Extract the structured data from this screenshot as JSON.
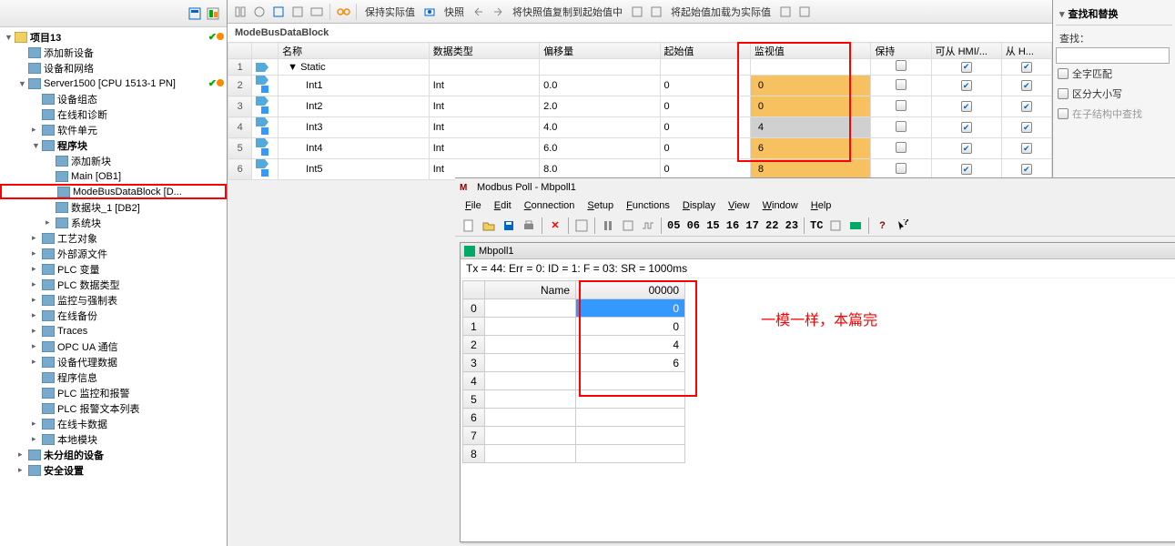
{
  "tree": {
    "root": "项目13",
    "items": [
      {
        "label": "添加新设备",
        "indent": 1,
        "arrow": "",
        "icon": "add-device"
      },
      {
        "label": "设备和网络",
        "indent": 1,
        "arrow": "",
        "icon": "network"
      },
      {
        "label": "Server1500 [CPU 1513-1 PN]",
        "indent": 1,
        "arrow": "▼",
        "icon": "plc",
        "status": true
      },
      {
        "label": "设备组态",
        "indent": 2,
        "arrow": "",
        "icon": "config"
      },
      {
        "label": "在线和诊断",
        "indent": 2,
        "arrow": "",
        "icon": "online"
      },
      {
        "label": "软件单元",
        "indent": 2,
        "arrow": "▸",
        "icon": "software"
      },
      {
        "label": "程序块",
        "indent": 2,
        "arrow": "▼",
        "icon": "blocks",
        "bold": true
      },
      {
        "label": "添加新块",
        "indent": 3,
        "arrow": "",
        "icon": "add-block"
      },
      {
        "label": "Main [OB1]",
        "indent": 3,
        "arrow": "",
        "icon": "ob"
      },
      {
        "label": "ModeBusDataBlock [D...",
        "indent": 3,
        "arrow": "",
        "icon": "db",
        "highlighted": true
      },
      {
        "label": "数据块_1 [DB2]",
        "indent": 3,
        "arrow": "",
        "icon": "db"
      },
      {
        "label": "系统块",
        "indent": 3,
        "arrow": "▸",
        "icon": "sys"
      },
      {
        "label": "工艺对象",
        "indent": 2,
        "arrow": "▸",
        "icon": "tech"
      },
      {
        "label": "外部源文件",
        "indent": 2,
        "arrow": "▸",
        "icon": "ext"
      },
      {
        "label": "PLC 变量",
        "indent": 2,
        "arrow": "▸",
        "icon": "tags"
      },
      {
        "label": "PLC 数据类型",
        "indent": 2,
        "arrow": "▸",
        "icon": "types"
      },
      {
        "label": "监控与强制表",
        "indent": 2,
        "arrow": "▸",
        "icon": "watch"
      },
      {
        "label": "在线备份",
        "indent": 2,
        "arrow": "▸",
        "icon": "backup"
      },
      {
        "label": "Traces",
        "indent": 2,
        "arrow": "▸",
        "icon": "traces"
      },
      {
        "label": "OPC UA 通信",
        "indent": 2,
        "arrow": "▸",
        "icon": "opcua"
      },
      {
        "label": "设备代理数据",
        "indent": 2,
        "arrow": "▸",
        "icon": "proxy"
      },
      {
        "label": "程序信息",
        "indent": 2,
        "arrow": "",
        "icon": "info"
      },
      {
        "label": "PLC 监控和报警",
        "indent": 2,
        "arrow": "",
        "icon": "alarm"
      },
      {
        "label": "PLC 报警文本列表",
        "indent": 2,
        "arrow": "",
        "icon": "alarmtext"
      },
      {
        "label": "在线卡数据",
        "indent": 2,
        "arrow": "▸",
        "icon": "card"
      },
      {
        "label": "本地模块",
        "indent": 2,
        "arrow": "▸",
        "icon": "local"
      },
      {
        "label": "未分组的设备",
        "indent": 1,
        "arrow": "▸",
        "icon": "ungrouped",
        "bold": true
      },
      {
        "label": "安全设置",
        "indent": 1,
        "arrow": "▸",
        "icon": "security",
        "bold": true
      }
    ]
  },
  "toolbar": {
    "keepActual": "保持实际值",
    "snapshot": "快照",
    "copyToStart": "将快照值复制到起始值中",
    "loadAsActual": "将起始值加载为实际值"
  },
  "block": {
    "title": "ModeBusDataBlock",
    "cols": {
      "name": "名称",
      "dtype": "数据类型",
      "offset": "偏移量",
      "start": "起始值",
      "monitor": "监视值",
      "retain": "保持",
      "hmi": "可从 HMI/...",
      "fromH": "从 H..."
    },
    "static_label": "Static",
    "rows": [
      {
        "n": 2,
        "name": "Int1",
        "dtype": "Int",
        "offset": "0.0",
        "start": "0",
        "monitor": "0",
        "retain": false,
        "hmi": true,
        "fromH": true
      },
      {
        "n": 3,
        "name": "Int2",
        "dtype": "Int",
        "offset": "2.0",
        "start": "0",
        "monitor": "0",
        "retain": false,
        "hmi": true,
        "fromH": true
      },
      {
        "n": 4,
        "name": "Int3",
        "dtype": "Int",
        "offset": "4.0",
        "start": "0",
        "monitor": "4",
        "retain": false,
        "hmi": true,
        "fromH": true,
        "gray": true
      },
      {
        "n": 5,
        "name": "Int4",
        "dtype": "Int",
        "offset": "6.0",
        "start": "0",
        "monitor": "6",
        "retain": false,
        "hmi": true,
        "fromH": true
      },
      {
        "n": 6,
        "name": "Int5",
        "dtype": "Int",
        "offset": "8.0",
        "start": "0",
        "monitor": "8",
        "retain": false,
        "hmi": true,
        "fromH": true
      }
    ]
  },
  "modbus": {
    "windowTitle": "Modbus Poll - Mbpoll1",
    "menus": [
      "File",
      "Edit",
      "Connection",
      "Setup",
      "Functions",
      "Display",
      "View",
      "Window",
      "Help"
    ],
    "tnums": "05 06 15 16 17 22 23",
    "tc_label": "TC",
    "innerTitle": "Mbpoll1",
    "statusLine": "Tx = 44: Err = 0: ID = 1: F = 03: SR = 1000ms",
    "gridHeaders": {
      "name": "Name",
      "val": "00000"
    },
    "gridRows": [
      {
        "i": "0",
        "name": "",
        "val": "0",
        "selected": true
      },
      {
        "i": "1",
        "name": "",
        "val": "0"
      },
      {
        "i": "2",
        "name": "",
        "val": "4"
      },
      {
        "i": "3",
        "name": "",
        "val": "6"
      },
      {
        "i": "4",
        "name": "",
        "val": ""
      },
      {
        "i": "5",
        "name": "",
        "val": ""
      },
      {
        "i": "6",
        "name": "",
        "val": ""
      },
      {
        "i": "7",
        "name": "",
        "val": ""
      },
      {
        "i": "8",
        "name": "",
        "val": ""
      }
    ],
    "annotation": "一模一样，本篇完"
  },
  "right": {
    "header": "查找和替换",
    "findLabel": "查找：",
    "wholeWord": "全字匹配",
    "matchCase": "区分大小写",
    "inSubstruct": "在子结构中查找"
  }
}
